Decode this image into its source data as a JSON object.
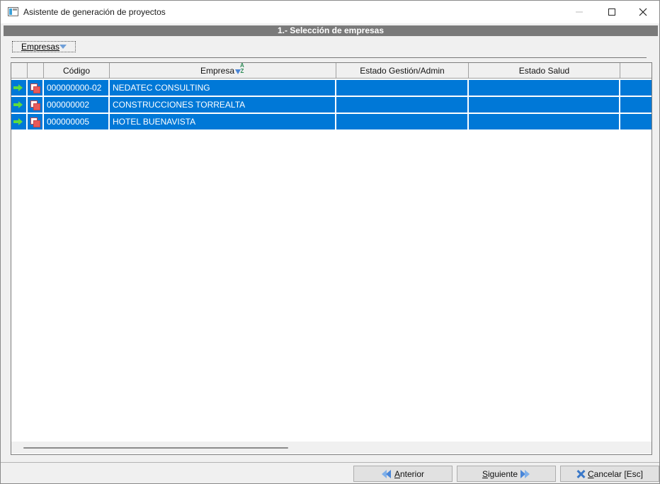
{
  "window": {
    "title": "Asistente de generación de proyectos",
    "icons": {
      "app": "window-app-icon",
      "minimize": "minimize-icon",
      "maximize": "maximize-icon",
      "close": "close-icon"
    }
  },
  "section": {
    "title": "1.- Selección de empresas"
  },
  "filter": {
    "label": "Empresas",
    "icon": "chevron-down-icon"
  },
  "grid": {
    "columns": [
      "",
      "",
      "Código",
      "Empresa",
      "Estado Gestión/Admin",
      "Estado Salud",
      ""
    ],
    "sort_icon": "sort-az-icon",
    "rows": [
      {
        "codigo": "000000000-02",
        "empresa": "NEDATEC CONSULTING",
        "estado_gestion": "",
        "estado_salud": ""
      },
      {
        "codigo": "000000002",
        "empresa": "CONSTRUCCIONES TORREALTA",
        "estado_gestion": "",
        "estado_salud": ""
      },
      {
        "codigo": "000000005",
        "empresa": "HOTEL BUENAVISTA",
        "estado_gestion": "",
        "estado_salud": ""
      }
    ]
  },
  "footer": {
    "anterior": {
      "pre": "",
      "underline": "A",
      "post": "nterior"
    },
    "siguiente": {
      "pre": "",
      "underline": "S",
      "post": "iguiente"
    },
    "cancelar": {
      "pre": "",
      "underline": "C",
      "post": "ancelar [Esc]"
    }
  },
  "colors": {
    "selection": "#0078d7",
    "section_bar": "#7a7a7a",
    "arrow_green": "#5ddc3c"
  }
}
